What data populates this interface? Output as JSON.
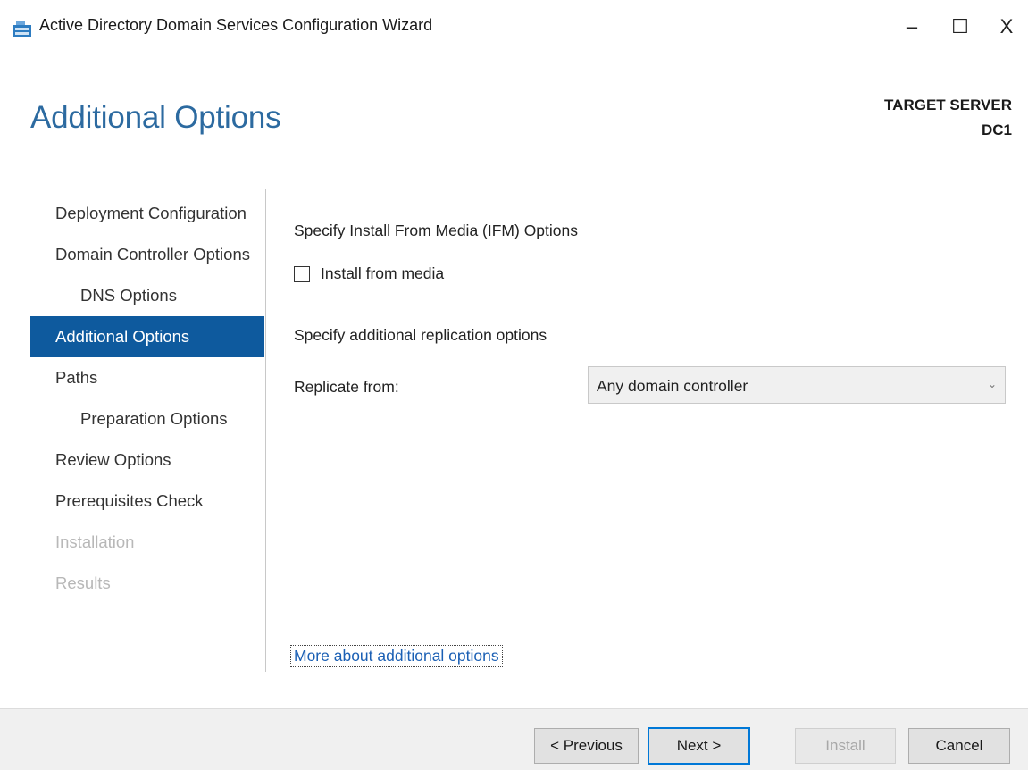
{
  "window": {
    "title": "Active Directory Domain Services Configuration Wizard",
    "icon": "server-icon",
    "controls": {
      "minimize": "–",
      "maximize": "☐",
      "close": "X"
    }
  },
  "header": {
    "page_title": "Additional Options",
    "target_label": "TARGET SERVER",
    "target_name": "DC1"
  },
  "nav": {
    "items": [
      {
        "label": "Deployment Configuration",
        "state": "normal"
      },
      {
        "label": "Domain Controller Options",
        "state": "normal"
      },
      {
        "label": "DNS Options",
        "state": "normal"
      },
      {
        "label": "Additional Options",
        "state": "active"
      },
      {
        "label": "Paths",
        "state": "normal"
      },
      {
        "label": "Preparation Options",
        "state": "normal"
      },
      {
        "label": "Review Options",
        "state": "normal"
      },
      {
        "label": "Prerequisites Check",
        "state": "normal"
      },
      {
        "label": "Installation",
        "state": "disabled"
      },
      {
        "label": "Results",
        "state": "disabled"
      }
    ]
  },
  "main": {
    "ifm_heading": "Specify Install From Media (IFM) Options",
    "install_from_media_label": "Install from media",
    "install_from_media_checked": false,
    "replication_heading": "Specify additional replication options",
    "replicate_from_label": "Replicate from:",
    "replicate_from_value": "Any domain controller",
    "more_link": "More about additional options"
  },
  "footer": {
    "previous": "< Previous",
    "next": "Next >",
    "install": "Install",
    "cancel": "Cancel"
  },
  "colors": {
    "title_blue": "#2c6aa0",
    "nav_active_bg": "#0e5a9e",
    "link_blue": "#1a5fb4",
    "disabled_gray": "#b8b8b8"
  }
}
